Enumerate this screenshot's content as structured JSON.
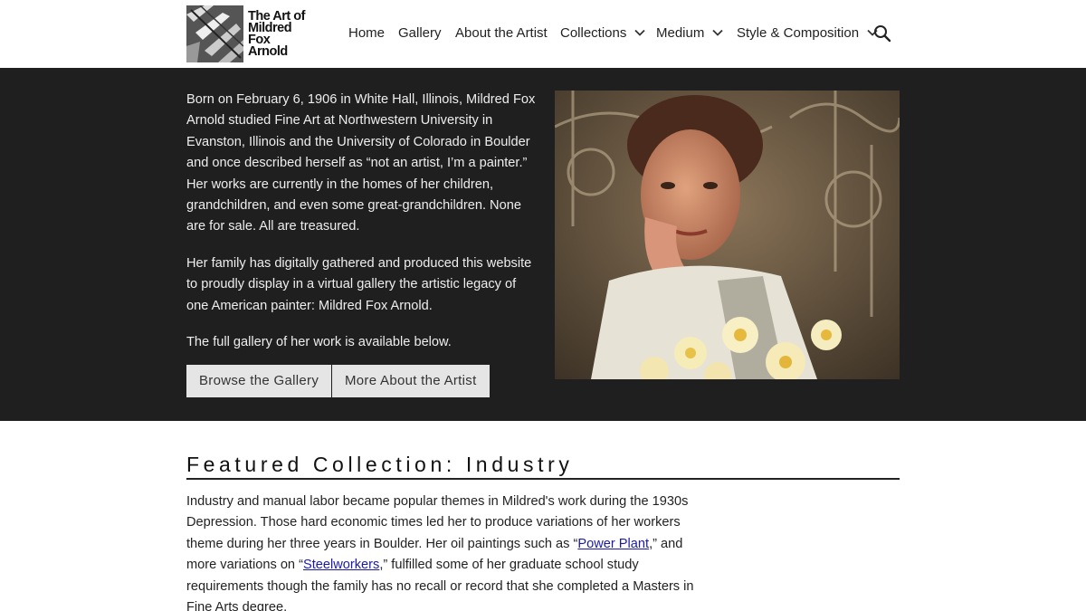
{
  "site": {
    "logo_lines": [
      "The Art of",
      "Mildred",
      "Fox",
      "Arnold"
    ]
  },
  "nav": {
    "items": [
      {
        "label": "Home",
        "dropdown": false
      },
      {
        "label": "Gallery",
        "dropdown": false
      },
      {
        "label": "About the Artist",
        "dropdown": false
      },
      {
        "label": "Collections",
        "dropdown": true
      },
      {
        "label": "Medium",
        "dropdown": true
      },
      {
        "label": "Style & Composition",
        "dropdown": true
      }
    ],
    "search_icon": "search-icon",
    "chevron_icon": "chevron-down-icon"
  },
  "hero": {
    "paragraph1": "Born on February 6, 1906 in White Hall, Illinois, Mildred Fox Arnold studied Fine Art at Northwestern University in Evanston, Illinois and the University of Colorado in Boulder and once described herself as “not an artist, I’m a painter.” Her works are currently in the homes of her children, grandchildren, and even some great-grandchildren. None are for sale. All are treasured.",
    "paragraph2": "Her family has digitally gathered and produced this website to proudly display in a virtual gallery the artistic legacy of one American painter: Mildred Fox Arnold.",
    "paragraph3": "The full gallery of her work is available below.",
    "button_gallery": "Browse the Gallery",
    "button_artist": "More About the Artist"
  },
  "featured": {
    "title": "Featured Collection: Industry",
    "text_part1": "Industry and manual labor became popular themes in Mildred's work during the 1930s Depression. Those hard economic times led her to produce variations of her workers theme during her three years in Boulder. Her oil paintings such as “",
    "link1": "Power Plant",
    "text_part2": ",” and more variations on “",
    "link2": "Steelworkers",
    "text_part3": ",” fulfilled some of her graduate school study requirements though the family has no recall or record that she completed a Masters in Fine Arts degree."
  },
  "colors": {
    "hero_bg": "#1f1f1f",
    "button_bg": "#e5e5e5",
    "link": "#1a1aa6"
  }
}
